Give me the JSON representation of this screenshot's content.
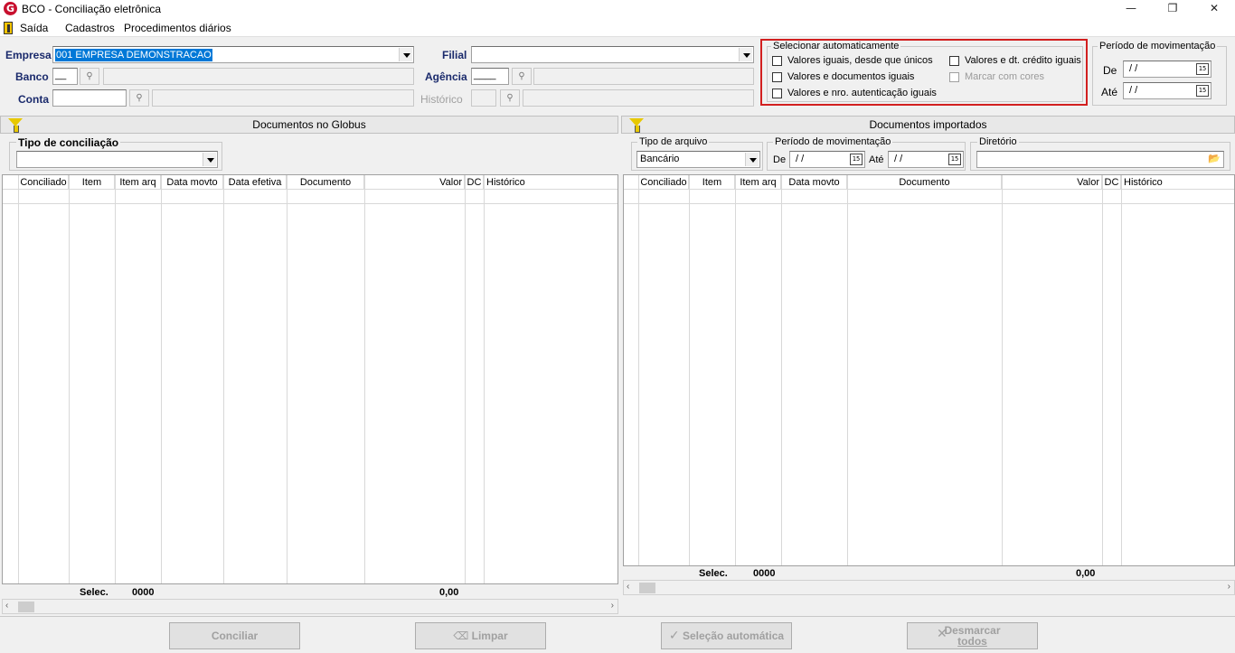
{
  "window": {
    "title": "BCO - Conciliação eletrônica",
    "app_icon": "G",
    "minimize": "—",
    "restore": "❐",
    "close": "✕"
  },
  "menu": [
    "Saída",
    "Cadastros",
    "Procedimentos diários"
  ],
  "filters": {
    "empresa_label": "Empresa",
    "empresa_value": "001 EMPRESA DEMONSTRACAO",
    "filial_label": "Filial",
    "banco_label": "Banco",
    "banco_code": "__",
    "agencia_label": "Agência",
    "agencia_code": "____",
    "conta_label": "Conta",
    "historico_label": "Histórico"
  },
  "auto_select": {
    "title": "Selecionar automaticamente",
    "opt1": "Valores iguais, desde que únicos",
    "opt2": "Valores e documentos iguais",
    "opt3": "Valores e nro. autenticação iguais",
    "opt4": "Valores e dt. crédito iguais",
    "opt5": "Marcar com cores"
  },
  "period_top": {
    "title": "Período de movimentação",
    "de_label": "De",
    "de_value": " / /",
    "ate_label": "Até",
    "ate_value": " / /",
    "cal": "15"
  },
  "left_panel": {
    "title": "Documentos no Globus",
    "tipo_label": "Tipo de conciliação",
    "columns": [
      "Conciliado",
      "Item",
      "Item arq",
      "Data movto",
      "Data efetiva",
      "Documento",
      "Valor",
      "DC",
      "Histórico"
    ],
    "selec_label": "Selec.",
    "selec_count": "0000",
    "total": "0,00"
  },
  "right_panel": {
    "title": "Documentos importados",
    "tipo_arquivo_label": "Tipo de arquivo",
    "tipo_arquivo_value": "Bancário",
    "periodo_label": "Período de movimentação",
    "de_label": "De",
    "de_value": " / /",
    "ate_label": "Até",
    "ate_value": " / /",
    "diretorio_label": "Diretório",
    "columns": [
      "Conciliado",
      "Item",
      "Item arq",
      "Data movto",
      "Documento",
      "Valor",
      "DC",
      "Histórico"
    ],
    "selec_label": "Selec.",
    "selec_count": "0000",
    "total": "0,00"
  },
  "buttons": {
    "conciliar": "Conciliar",
    "limpar": "Limpar",
    "selecao": "Seleção automática",
    "desmarcar_1": "Desmarcar",
    "desmarcar_2": "todos"
  },
  "colors": {
    "highlight": "#d21f1f",
    "selection": "#0078d7",
    "label": "#1a2a6c"
  }
}
